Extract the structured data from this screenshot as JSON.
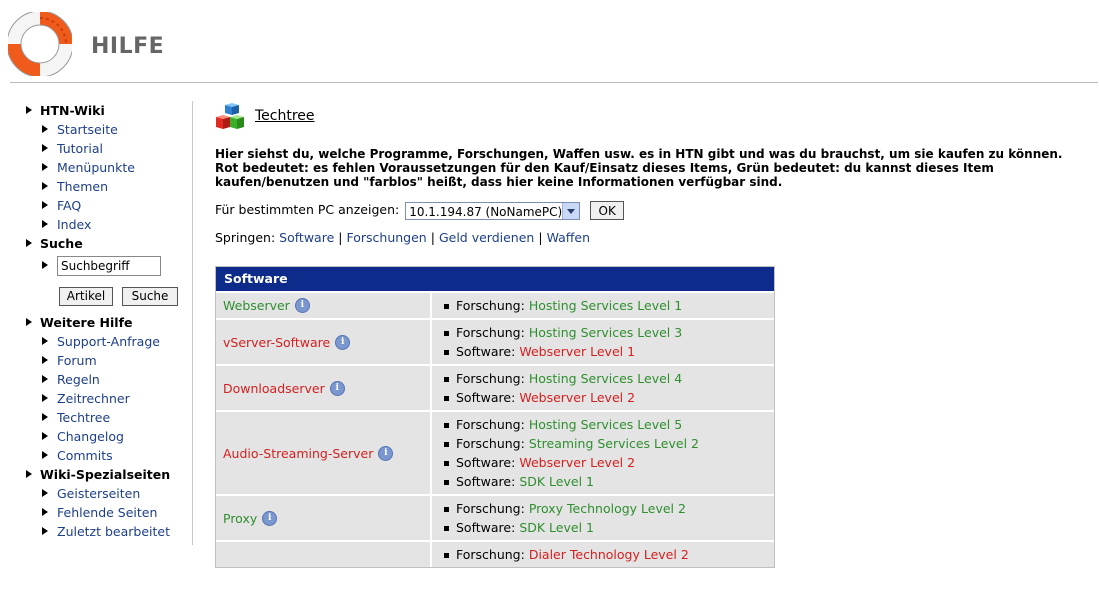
{
  "header": {
    "title": "HILFE"
  },
  "sidebar": {
    "sections": [
      {
        "label": "HTN-Wiki",
        "items": [
          "Startseite",
          "Tutorial",
          "Menüpunkte",
          "Themen",
          "FAQ",
          "Index"
        ]
      },
      {
        "label": "Suche"
      },
      {
        "label": "Weitere Hilfe",
        "items": [
          "Support-Anfrage",
          "Forum",
          "Regeln",
          "Zeitrechner",
          "Techtree",
          "Changelog",
          "Commits"
        ]
      },
      {
        "label": "Wiki-Spezialseiten",
        "items": [
          "Geisterseiten",
          "Fehlende Seiten",
          "Zuletzt bearbeitet"
        ]
      }
    ],
    "search": {
      "value": "Suchbegriff",
      "article_button": "Artikel",
      "search_button": "Suche"
    }
  },
  "main": {
    "title": "Techtree",
    "intro_1": "Hier siehst du, welche Programme, Forschungen, Waffen usw. es in HTN gibt und was du brauchst, um sie kaufen zu können.",
    "intro_2": "Rot bedeutet: es fehlen Voraussetzungen für den Kauf/Einsatz dieses Items, Grün bedeutet: du kannst dieses Item kaufen/benutzen und \"farblos\" heißt, dass hier keine Informationen verfügbar sind.",
    "pc_label": "Für bestimmten PC anzeigen:",
    "pc_selected": "10.1.194.87 (NoNamePC)",
    "ok_label": "OK",
    "jump_label": "Springen:",
    "jump_links": [
      "Software",
      "Forschungen",
      "Geld verdienen",
      "Waffen"
    ],
    "table": {
      "header": "Software",
      "info_glyph": "i",
      "rows": [
        {
          "name": "Webserver",
          "color": "green",
          "reqs": [
            {
              "kind": "Forschung:",
              "item": "Hosting Services Level 1",
              "color": "green"
            }
          ]
        },
        {
          "name": "vServer-Software",
          "color": "red",
          "reqs": [
            {
              "kind": "Forschung:",
              "item": "Hosting Services Level 3",
              "color": "green"
            },
            {
              "kind": "Software:",
              "item": "Webserver Level 1",
              "color": "red"
            }
          ]
        },
        {
          "name": "Downloadserver",
          "color": "red",
          "reqs": [
            {
              "kind": "Forschung:",
              "item": "Hosting Services Level 4",
              "color": "green"
            },
            {
              "kind": "Software:",
              "item": "Webserver Level 2",
              "color": "red"
            }
          ]
        },
        {
          "name": "Audio-Streaming-Server",
          "color": "red",
          "reqs": [
            {
              "kind": "Forschung:",
              "item": "Hosting Services Level 5",
              "color": "green"
            },
            {
              "kind": "Forschung:",
              "item": "Streaming Services Level 2",
              "color": "green"
            },
            {
              "kind": "Software:",
              "item": "Webserver Level 2",
              "color": "red"
            },
            {
              "kind": "Software:",
              "item": "SDK Level 1",
              "color": "green"
            }
          ]
        },
        {
          "name": "Proxy",
          "color": "green",
          "reqs": [
            {
              "kind": "Forschung:",
              "item": "Proxy Technology Level 2",
              "color": "green"
            },
            {
              "kind": "Software:",
              "item": "SDK Level 1",
              "color": "green"
            }
          ]
        },
        {
          "name": "",
          "color": "red",
          "reqs": [
            {
              "kind": "Forschung:",
              "item": "Dialer Technology Level 2",
              "color": "red"
            }
          ]
        }
      ]
    }
  },
  "colors": {
    "green": "#2f8f2f",
    "red": "#d42020",
    "table_header": "#0d2b8a",
    "link": "#1e3f8a"
  },
  "icons": {
    "logo": "lifebuoy-icon",
    "techtree": "cubes-icon",
    "info": "info-icon"
  }
}
